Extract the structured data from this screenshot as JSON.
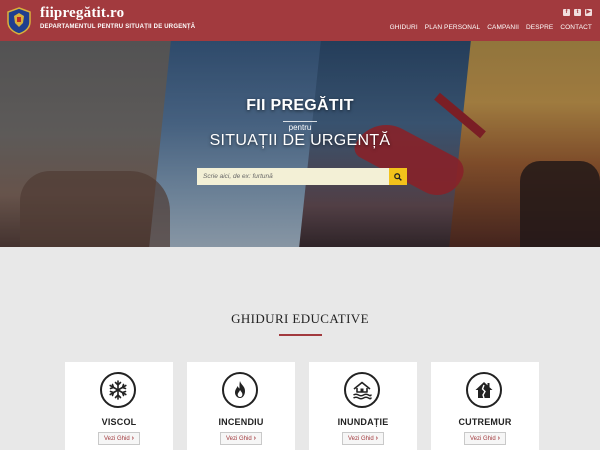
{
  "header": {
    "site_name": "fiipregătit.ro",
    "subtitle": "DEPARTAMENTUL PENTRU SITUAȚII DE URGENȚĂ",
    "social": [
      "f",
      "t",
      "▶"
    ],
    "nav": [
      "GHIDURI",
      "PLAN PERSONAL",
      "CAMPANII",
      "DESPRE",
      "CONTACT"
    ],
    "brand_color": "#a23a3e"
  },
  "hero": {
    "title_line1": "FII PREGĂTIT",
    "title_line2": "pentru",
    "title_line3": "SITUAȚII DE URGENȚĂ",
    "search_placeholder": "Scrie aici, de ex: furtună"
  },
  "guides": {
    "section_title": "GHIDURI EDUCATIVE",
    "button_label": "Vezi Ghid",
    "cards": [
      {
        "title": "VISCOL",
        "icon": "snowflake-icon"
      },
      {
        "title": "INCENDIU",
        "icon": "fire-icon"
      },
      {
        "title": "INUNDAȚIE",
        "icon": "flood-icon"
      },
      {
        "title": "CUTREMUR",
        "icon": "earthquake-icon"
      }
    ]
  }
}
